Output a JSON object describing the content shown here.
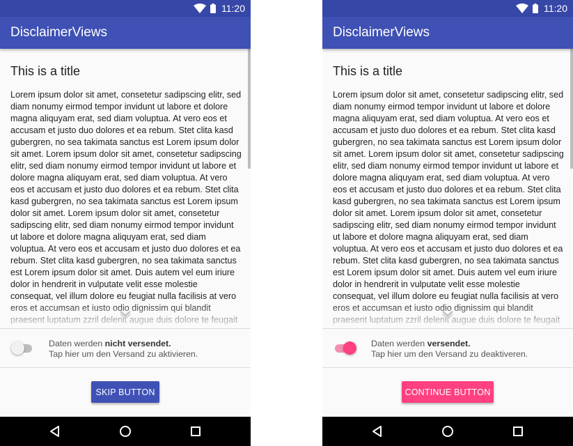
{
  "colors": {
    "primary": "#3f51b5",
    "primary_dark": "#3647a8",
    "accent": "#ff4081"
  },
  "status": {
    "time": "11:20"
  },
  "app": {
    "title": "DisclaimerViews"
  },
  "content": {
    "title": "This is a title",
    "body": "Lorem ipsum dolor sit amet, consetetur sadipscing elitr, sed diam nonumy eirmod tempor invidunt ut labore et dolore magna aliquyam erat, sed diam voluptua. At vero eos et accusam et justo duo dolores et ea rebum. Stet clita kasd gubergren, no sea takimata sanctus est Lorem ipsum dolor sit amet. Lorem ipsum dolor sit amet, consetetur sadipscing elitr, sed diam nonumy eirmod tempor invidunt ut labore et dolore magna aliquyam erat, sed diam voluptua. At vero eos et accusam et justo duo dolores et ea rebum. Stet clita kasd gubergren, no sea takimata sanctus est Lorem ipsum dolor sit amet. Lorem ipsum dolor sit amet, consetetur sadipscing elitr, sed diam nonumy eirmod tempor invidunt ut labore et dolore magna aliquyam erat, sed diam voluptua. At vero eos et accusam et justo duo dolores et ea rebum. Stet clita kasd gubergren, no sea takimata sanctus est Lorem ipsum dolor sit amet. Duis autem vel eum iriure dolor in hendrerit in vulputate velit esse molestie consequat, vel illum dolore eu feugiat nulla facilisis at vero eros et accumsan et iusto odio dignissim qui blandit praesent luptatum zzril delenit augue duis dolore te feugait nulla facilisi. Lorem ipsum dolor"
  },
  "screens": {
    "left": {
      "toggle": {
        "state": "off",
        "line1_prefix": "Daten werden ",
        "line1_bold": "nicht versendet.",
        "line2": "Tap hier um den Versand zu aktivieren."
      },
      "button_label": "SKIP BUTTON"
    },
    "right": {
      "toggle": {
        "state": "on",
        "line1_prefix": "Daten werden ",
        "line1_bold": "versendet.",
        "line2": "Tap hier um den Versand zu deaktiveren."
      },
      "button_label": "CONTINUE BUTTON"
    }
  },
  "icons": {
    "status": [
      "wifi-icon",
      "battery-icon"
    ],
    "content": [
      "chevron-down-icon"
    ],
    "navigation": [
      "back-icon",
      "home-icon",
      "recents-icon"
    ]
  }
}
